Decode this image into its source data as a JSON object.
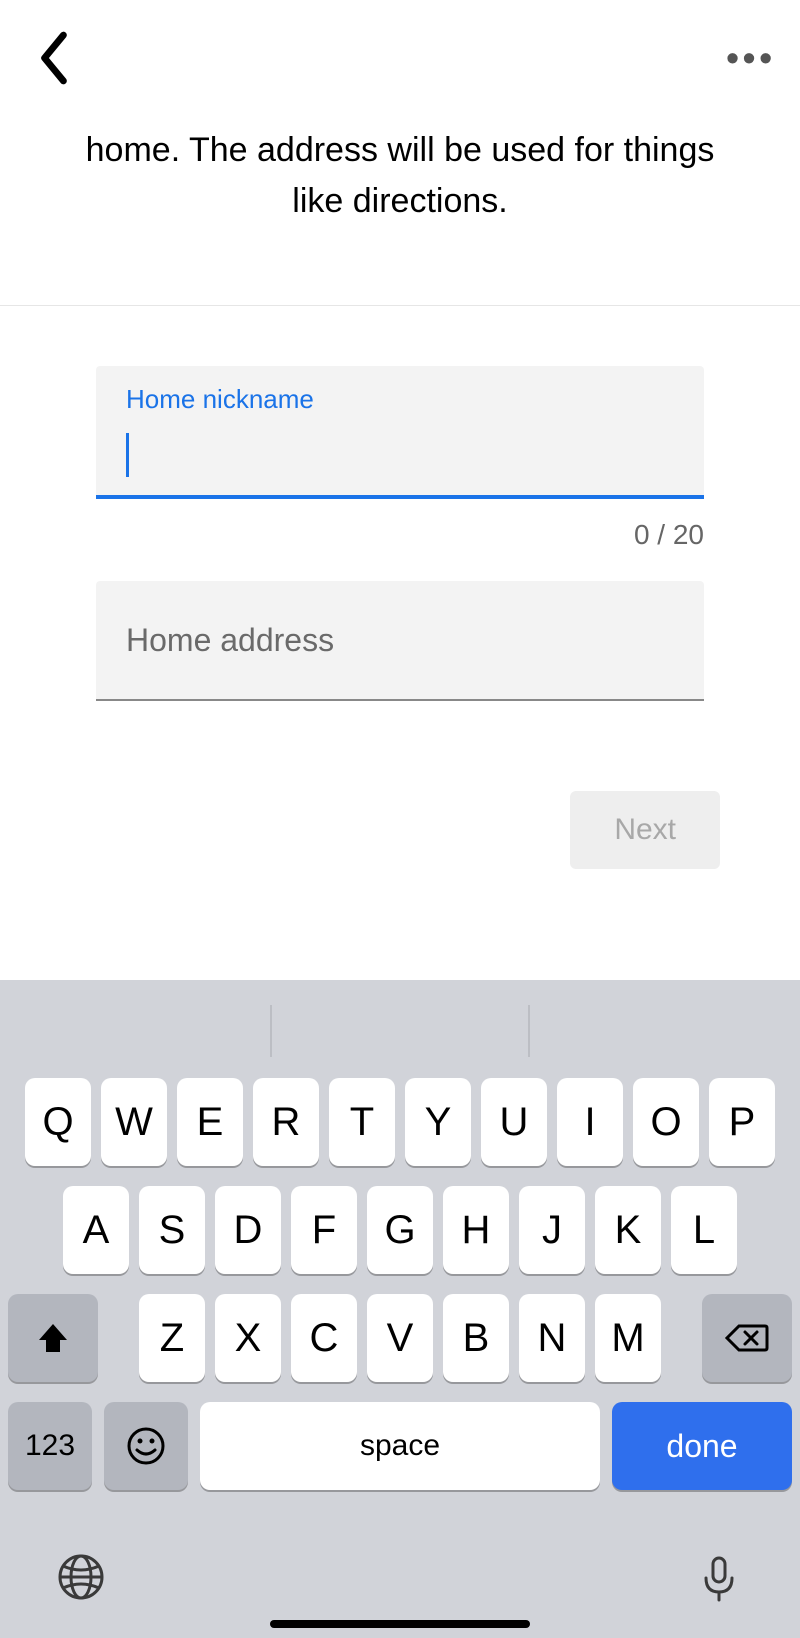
{
  "nav": {
    "back_icon": "chevron-left-icon",
    "more_label": "•••"
  },
  "intro": {
    "text": "home. The address will be used for things like directions."
  },
  "form": {
    "nickname": {
      "label": "Home nickname",
      "value": "",
      "counter": "0 / 20"
    },
    "address": {
      "placeholder": "Home address",
      "value": ""
    },
    "next_label": "Next"
  },
  "keyboard": {
    "row1": [
      "Q",
      "W",
      "E",
      "R",
      "T",
      "Y",
      "U",
      "I",
      "O",
      "P"
    ],
    "row2": [
      "A",
      "S",
      "D",
      "F",
      "G",
      "H",
      "J",
      "K",
      "L"
    ],
    "row3": [
      "Z",
      "X",
      "C",
      "V",
      "B",
      "N",
      "M"
    ],
    "num_label": "123",
    "space_label": "space",
    "done_label": "done"
  }
}
